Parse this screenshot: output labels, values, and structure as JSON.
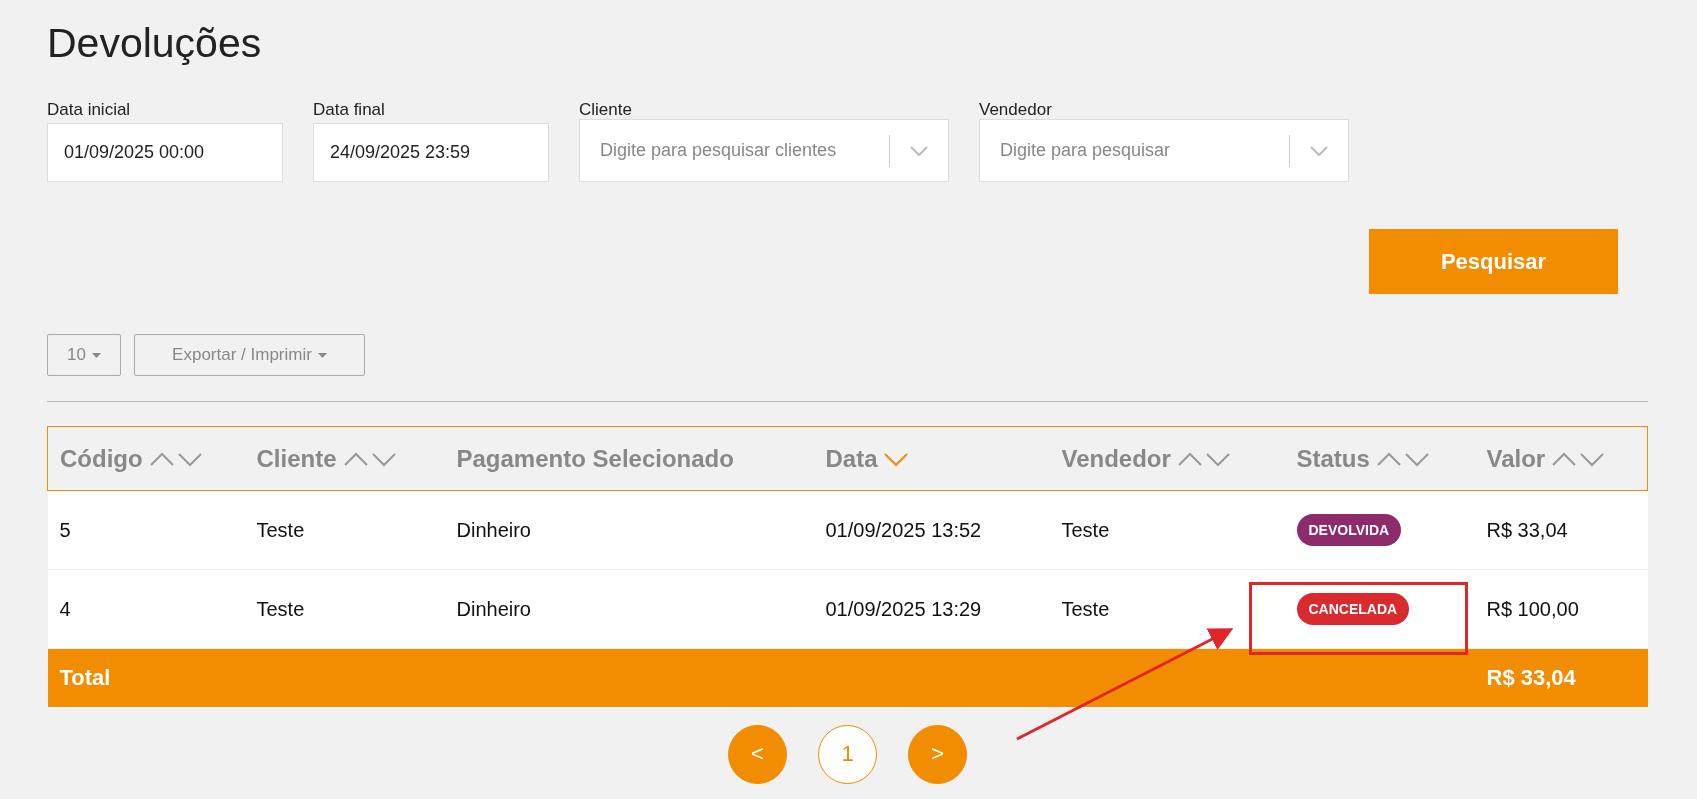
{
  "title": "Devoluções",
  "filters": [
    {
      "kind": "date",
      "label": "Data inicial",
      "value": "01/09/2025 00:00"
    },
    {
      "kind": "date",
      "label": "Data final",
      "value": "24/09/2025 23:59"
    },
    {
      "kind": "select",
      "label": "Cliente",
      "placeholder": "Digite para pesquisar clientes"
    },
    {
      "kind": "select",
      "label": "Vendedor",
      "placeholder": "Digite para pesquisar"
    }
  ],
  "search_button": "Pesquisar",
  "toolbar": {
    "page_size": "10",
    "export": "Exportar / Imprimir"
  },
  "table": {
    "columns": [
      {
        "label": "Código",
        "sortable": true,
        "sorted_descending": false
      },
      {
        "label": "Cliente",
        "sortable": true,
        "sorted_descending": false
      },
      {
        "label": "Pagamento Selecionado",
        "sortable": false
      },
      {
        "label": "Data",
        "sortable": true,
        "sorted_descending": true
      },
      {
        "label": "Vendedor",
        "sortable": true,
        "sorted_descending": false
      },
      {
        "label": "Status",
        "sortable": true,
        "sorted_descending": false
      },
      {
        "label": "Valor",
        "sortable": true,
        "sorted_descending": false
      }
    ],
    "rows": [
      {
        "codigo": "5",
        "cliente": "Teste",
        "pagamento": "Dinheiro",
        "data": "01/09/2025 13:52",
        "vendedor": "Teste",
        "status": {
          "label": "DEVOLVIDA",
          "color": "#8e2b6d"
        },
        "valor": "R$ 33,04"
      },
      {
        "codigo": "4",
        "cliente": "Teste",
        "pagamento": "Dinheiro",
        "data": "01/09/2025 13:29",
        "vendedor": "Teste",
        "status": {
          "label": "CANCELADA",
          "color": "#d92b2f"
        },
        "valor": "R$ 100,00"
      }
    ],
    "total": {
      "label": "Total",
      "value": "R$ 33,04"
    }
  },
  "pagination": {
    "prev": "<",
    "pages": [
      {
        "label": "1",
        "selected": true
      }
    ],
    "next": ">"
  }
}
